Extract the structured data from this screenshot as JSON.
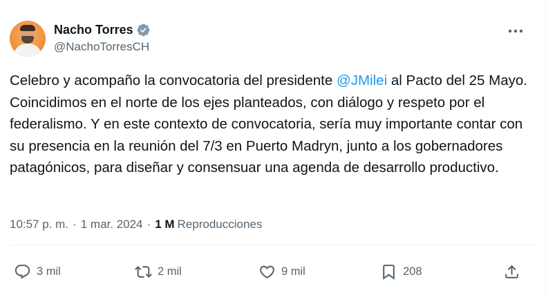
{
  "author": {
    "display_name": "Nacho Torres",
    "handle": "@NachoTorresCH",
    "verified_icon": "verified-badge-icon"
  },
  "tweet": {
    "text_before_mention": "Celebro y acompaño la convocatoria del presidente ",
    "mention": "@JMilei",
    "text_after_mention": " al Pacto del 25 Mayo. Coincidimos en el norte de los ejes planteados, con diálogo y respeto por el federalismo. Y en este contexto de convocatoria, sería muy importante contar con su presencia en la reunión del 7/3 en Puerto Madryn, junto a los gobernadores patagónicos, para diseñar y consensuar una agenda de desarrollo productivo."
  },
  "meta": {
    "time": "10:57 p. m.",
    "separator": "·",
    "date": "1 mar. 2024",
    "views_count": "1 M",
    "views_label": "Reproducciones"
  },
  "actions": {
    "reply_count": "3 mil",
    "retweet_count": "2 mil",
    "like_count": "9 mil",
    "bookmark_count": "208"
  },
  "colors": {
    "link": "#1d9bf0",
    "secondary_text": "#536471",
    "primary_text": "#0f1419",
    "verified": "#829aab"
  }
}
